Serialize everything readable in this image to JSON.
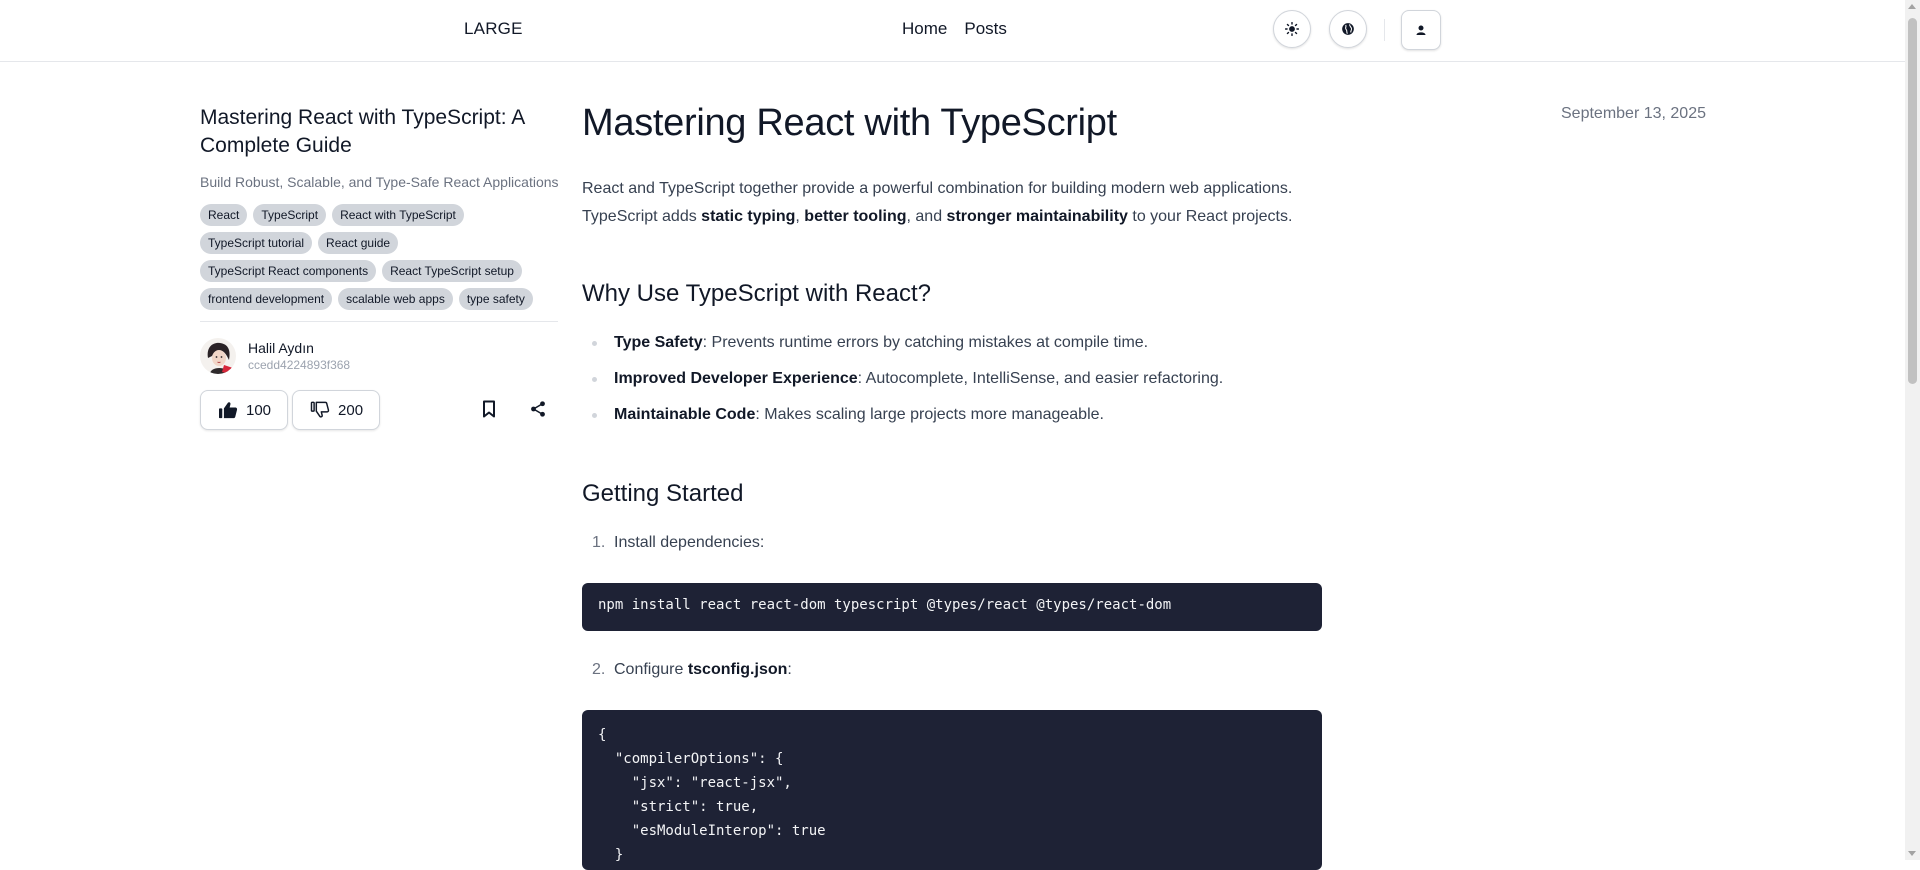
{
  "header": {
    "brand": "LARGE",
    "nav": [
      "Home",
      "Posts"
    ]
  },
  "sidebar": {
    "title": "Mastering React with TypeScript: A Complete Guide",
    "subtitle": "Build Robust, Scalable, and Type-Safe React Applications",
    "tags": [
      "React",
      "TypeScript",
      "React with TypeScript",
      "TypeScript tutorial",
      "React guide",
      "TypeScript React components",
      "React TypeScript setup",
      "frontend development",
      "scalable web apps",
      "type safety"
    ],
    "author": {
      "name": "Halil Aydın",
      "id": "ccedd4224893f368"
    },
    "likes": "100",
    "dislikes": "200"
  },
  "article": {
    "date": "September 13, 2025",
    "title": "Mastering React with TypeScript",
    "intro": {
      "p1": "React and TypeScript together provide a powerful combination for building modern web applications. TypeScript adds ",
      "b1": "static typing",
      "p2": ", ",
      "b2": "better tooling",
      "p3": ", and ",
      "b3": "stronger maintainability",
      "p4": " to your React projects."
    },
    "why_heading": "Why Use TypeScript with React?",
    "bullets": [
      {
        "bold": "Type Safety",
        "text": ": Prevents runtime errors by catching mistakes at compile time."
      },
      {
        "bold": "Improved Developer Experience",
        "text": ": Autocomplete, IntelliSense, and easier refactoring."
      },
      {
        "bold": "Maintainable Code",
        "text": ": Makes scaling large projects more manageable."
      }
    ],
    "getting_heading": "Getting Started",
    "step1": {
      "num": "1.",
      "text": "Install dependencies:"
    },
    "code1": "npm install react react-dom typescript @types/react @types/react-dom",
    "step2": {
      "num": "2.",
      "text": "Configure ",
      "bold": "tsconfig.json",
      "after": ":"
    },
    "code2": "{\n  \"compilerOptions\": {\n    \"jsx\": \"react-jsx\",\n    \"strict\": true,\n    \"esModuleInterop\": true\n  }"
  }
}
